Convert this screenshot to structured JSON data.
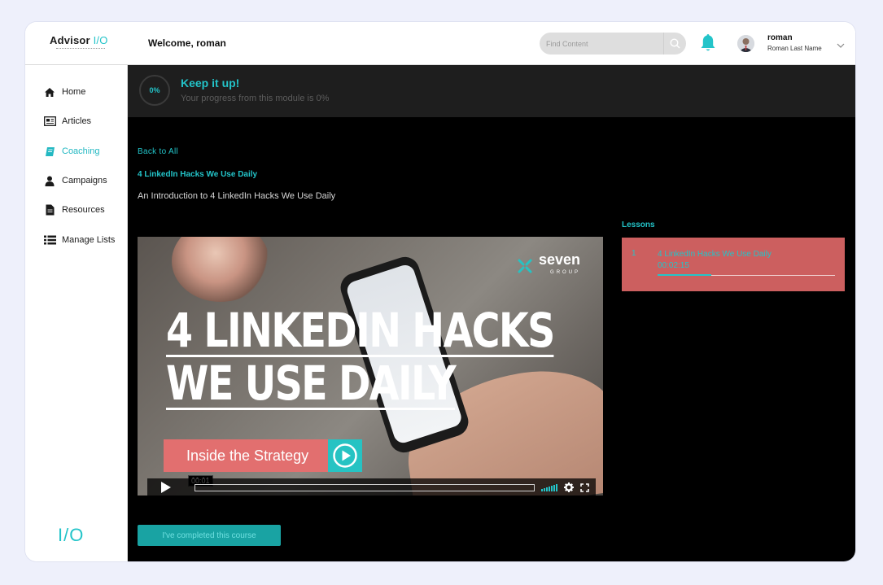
{
  "app": {
    "logo_name": "Advisor",
    "logo_io": "I/O",
    "welcome": "Welcome, roman"
  },
  "search": {
    "placeholder": "Find Content"
  },
  "user": {
    "name": "roman",
    "full_name": "Roman Last Name"
  },
  "sidebar": {
    "items": [
      {
        "label": "Home",
        "icon": "home-icon",
        "active": false
      },
      {
        "label": "Articles",
        "icon": "newspaper-icon",
        "active": false
      },
      {
        "label": "Coaching",
        "icon": "book-icon",
        "active": true
      },
      {
        "label": "Campaigns",
        "icon": "user-icon",
        "active": false
      },
      {
        "label": "Resources",
        "icon": "document-icon",
        "active": false
      },
      {
        "label": "Manage Lists",
        "icon": "list-icon",
        "active": false
      }
    ],
    "footer_mark": "I/O"
  },
  "progress": {
    "percent_label": "0%",
    "title": "Keep it up!",
    "subtitle": "Your progress from this module is 0%"
  },
  "course": {
    "back_label": "Back to All",
    "title": "4 LinkedIn Hacks We Use Daily",
    "subtitle": "An Introduction to 4 LinkedIn Hacks We Use Daily"
  },
  "video": {
    "brand": "seven",
    "brand_sub": "GROUP",
    "headline_line1": "4 LINKEDIN HACKS",
    "headline_line2": "WE USE DAILY",
    "cta": "Inside the Strategy",
    "time": "00:01"
  },
  "lessons": {
    "heading": "Lessons",
    "items": [
      {
        "number": "1",
        "title": "4 LinkedIn Hacks We Use Daily",
        "duration": "00:02:15",
        "progress": 0.3
      }
    ]
  },
  "complete_button": "I've completed this course",
  "colors": {
    "accent": "#23c4c9",
    "lesson_bg": "#cc5f5f",
    "cta": "#e26f6f"
  }
}
